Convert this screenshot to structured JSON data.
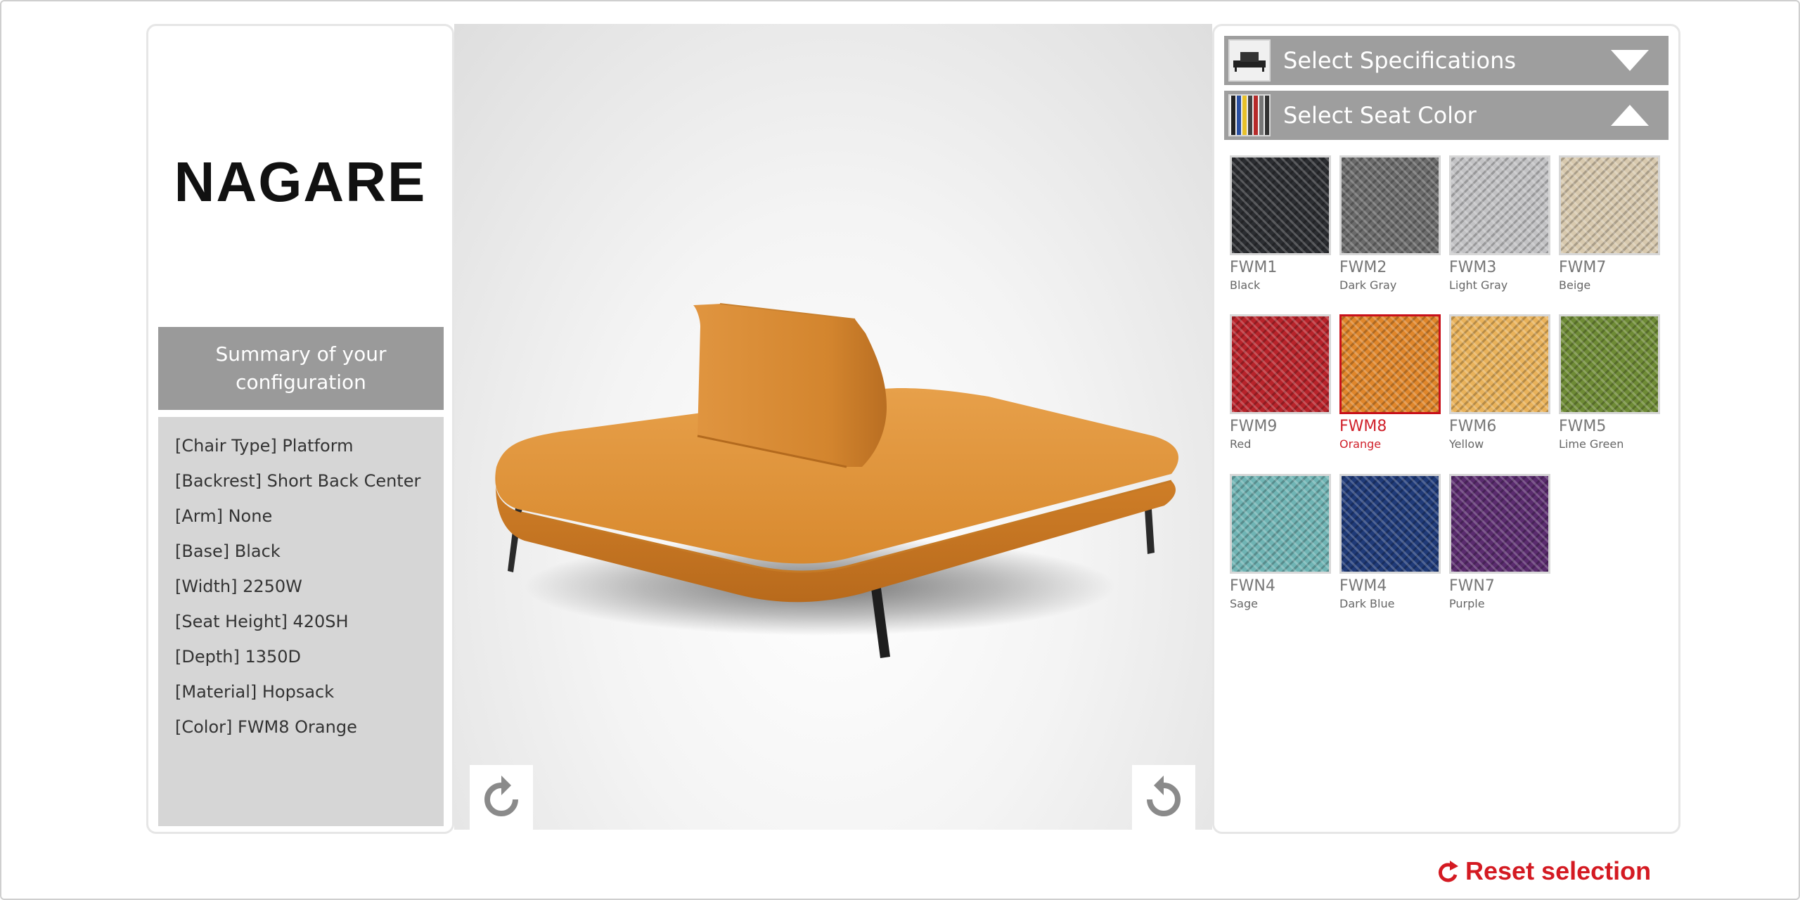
{
  "brand": "NAGARE",
  "summary": {
    "title": "Summary of your configuration",
    "lines": [
      "[Chair Type] Platform",
      "[Backrest] Short Back Center",
      "[Arm] None",
      "[Base] Black",
      "[Width] 2250W",
      "[Seat Height] 420SH",
      "[Depth] 1350D",
      "[Material] Hopsack",
      "[Color] FWM8 Orange"
    ]
  },
  "accordion": {
    "specifications": {
      "label": "Select Specifications",
      "state": "collapsed"
    },
    "seat_color": {
      "label": "Select Seat Color",
      "state": "expanded"
    }
  },
  "swatches": [
    {
      "code": "FWM1",
      "name": "Black",
      "color": "#2b2d31"
    },
    {
      "code": "FWM2",
      "name": "Dark Gray",
      "color": "#6a6a6a"
    },
    {
      "code": "FWM3",
      "name": "Light Gray",
      "color": "#c2c2c4"
    },
    {
      "code": "FWM7",
      "name": "Beige",
      "color": "#d8c9ae"
    },
    {
      "code": "FWM9",
      "name": "Red",
      "color": "#b8232a"
    },
    {
      "code": "FWM8",
      "name": "Orange",
      "color": "#e0862a",
      "selected": true
    },
    {
      "code": "FWM6",
      "name": "Yellow",
      "color": "#e9b25a"
    },
    {
      "code": "FWM5",
      "name": "Lime Green",
      "color": "#6e8b35"
    },
    {
      "code": "FWN4",
      "name": "Sage",
      "color": "#6fb4b4"
    },
    {
      "code": "FWM4",
      "name": "Dark Blue",
      "color": "#1f3a78"
    },
    {
      "code": "FWN7",
      "name": "Purple",
      "color": "#5a2b6e"
    }
  ],
  "reset_label": "Reset selection",
  "colors": {
    "accent_red": "#d41a22",
    "panel_gray": "#9e9e9e",
    "sofa_orange": "#d9882f"
  }
}
